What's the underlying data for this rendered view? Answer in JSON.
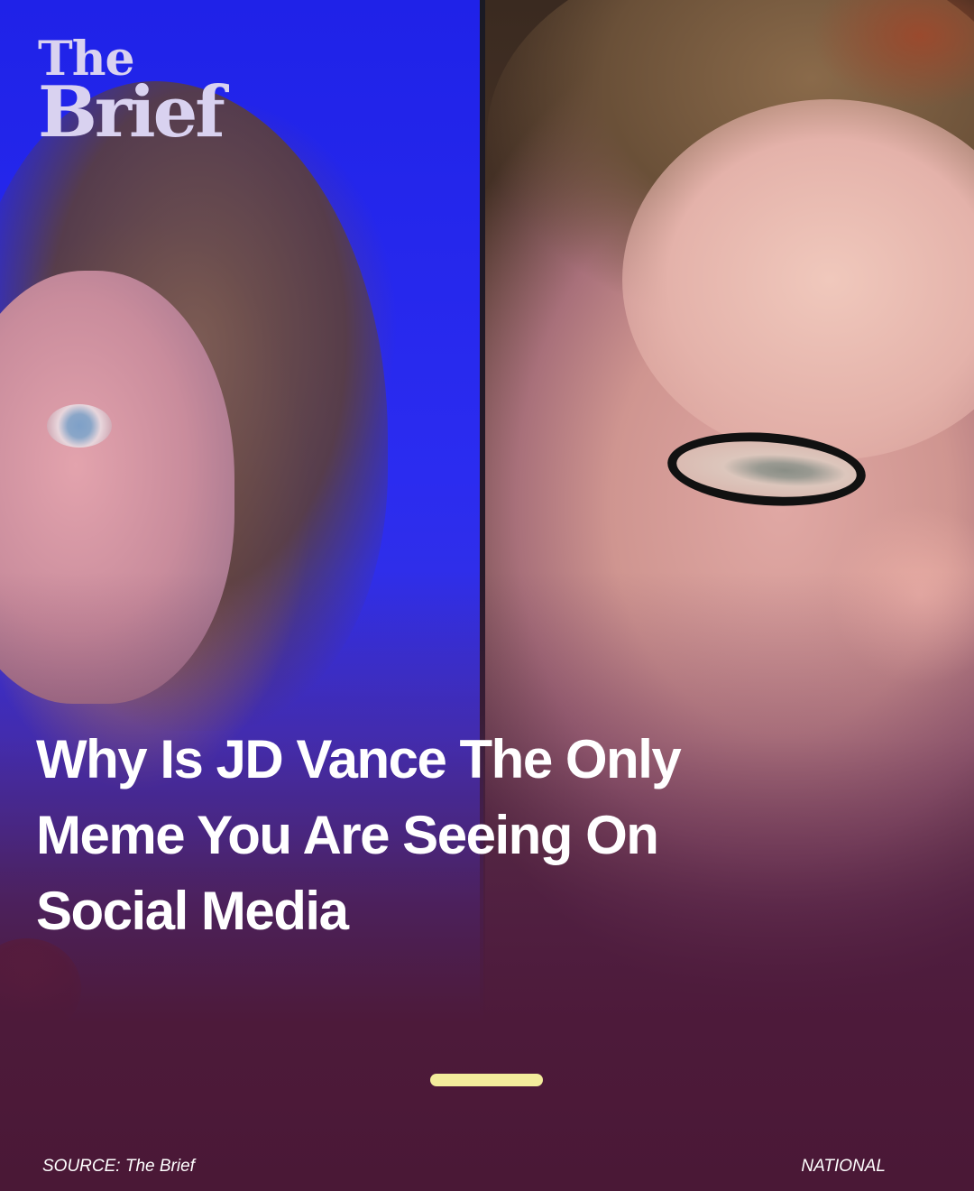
{
  "logo": {
    "line1": "The",
    "line2": "Brief"
  },
  "headline": "Why Is JD Vance The Only Meme You Are Seeing On Social Media",
  "footer": {
    "source": "SOURCE: The Brief",
    "category": "NATIONAL"
  },
  "pager": {
    "active_index": 0
  },
  "colors": {
    "background": "#4a1836",
    "pager_indicator": "#f3ec9c",
    "logo": "#d9d2f0",
    "headline": "#ffffff"
  }
}
